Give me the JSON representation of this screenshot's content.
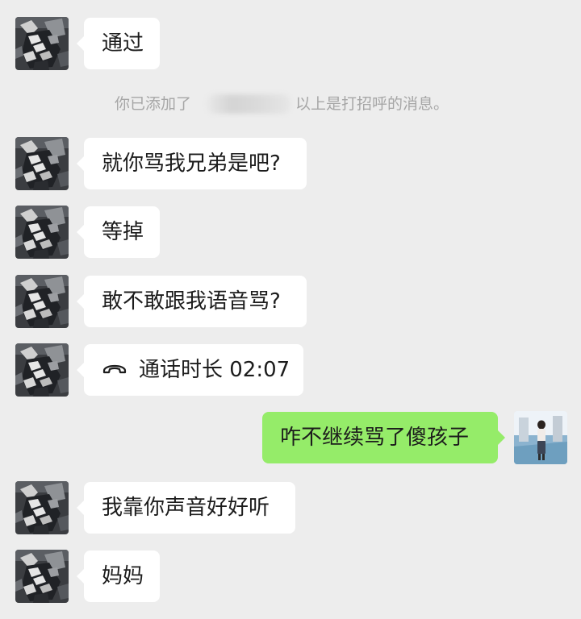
{
  "messages": [
    {
      "side": "left",
      "text": "通过"
    },
    {
      "side": "left",
      "text": "就你骂我兄弟是吧?"
    },
    {
      "side": "left",
      "text": "等掉"
    },
    {
      "side": "left",
      "text": "敢不敢跟我语音骂?"
    },
    {
      "side": "left",
      "text": "通话时长 02:07",
      "icon": "phone-hangup-icon"
    },
    {
      "side": "right",
      "text": "咋不继续骂了傻孩子"
    },
    {
      "side": "left",
      "text": "我靠你声音好好听"
    },
    {
      "side": "left",
      "text": "妈妈"
    }
  ],
  "system_notice": {
    "prefix": "你已添加了",
    "suffix": "以上是打招呼的消息。"
  },
  "colors": {
    "background": "#ededed",
    "incoming_bubble": "#ffffff",
    "outgoing_bubble": "#95ec69",
    "system_text": "#a6a6a6"
  }
}
